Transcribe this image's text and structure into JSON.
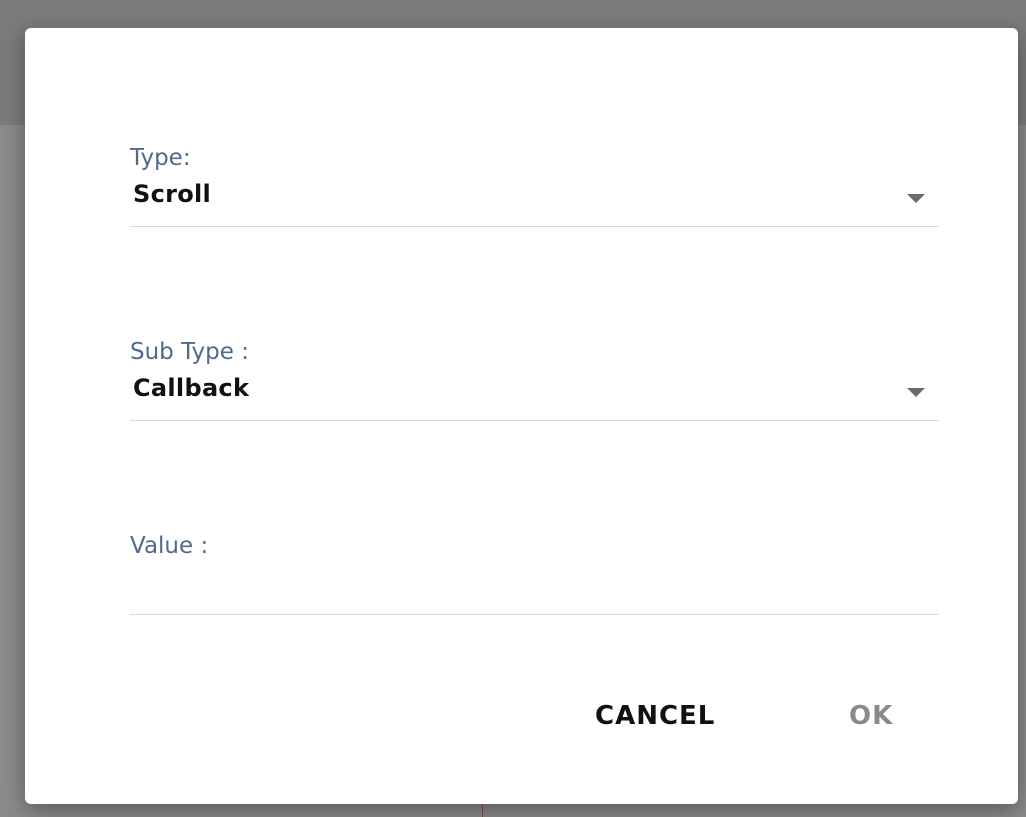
{
  "dialog": {
    "fields": {
      "type": {
        "label": "Type:",
        "value": "Scroll"
      },
      "sub_type": {
        "label": "Sub Type :",
        "value": "Callback"
      },
      "value": {
        "label": "Value :",
        "value": ""
      }
    },
    "buttons": {
      "cancel_label": "CANCEL",
      "ok_label": "OK"
    }
  },
  "colors": {
    "label": "#4f6b8a",
    "text": "#111111",
    "disabled": "#8a8a8a",
    "divider": "#d7d7d7",
    "overlay": "#8a8a8a"
  },
  "icons": {
    "dropdown": "caret-down-icon"
  }
}
